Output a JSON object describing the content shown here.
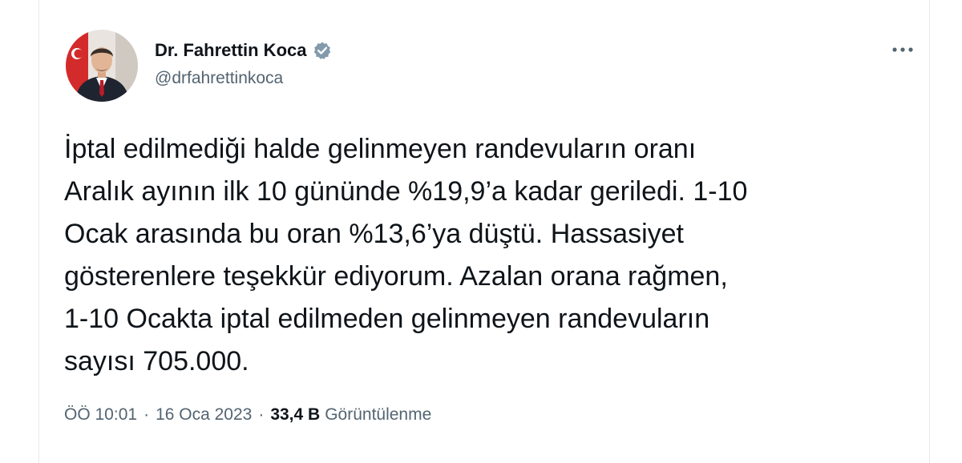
{
  "author": {
    "display_name": "Dr. Fahrettin Koca",
    "handle": "@drfahrettinkoca",
    "verified": true
  },
  "tweet": {
    "text": "İptal edilmediği halde gelinmeyen randevuların oranı\nAralık ayının ilk 10 gününde %19,9’a kadar geriledi. 1-10\nOcak arasında bu oran %13,6’ya düştü. Hassasiyet\ngösterenlere teşekkür ediyorum. Azalan orana rağmen,\n1-10 Ocakta iptal edilmeden gelinmeyen randevuların\nsayısı 705.000."
  },
  "meta": {
    "time": "ÖÖ 10:01",
    "separator": "·",
    "date": "16 Oca 2023",
    "views_count": "33,4 B",
    "views_label": "Görüntülenme"
  },
  "colors": {
    "text": "#0f1419",
    "secondary": "#536471",
    "verified_badge": "#829aab",
    "border": "#e6e9eb"
  },
  "icons": {
    "more": "more-dots-icon",
    "verified": "verified-badge-icon"
  }
}
